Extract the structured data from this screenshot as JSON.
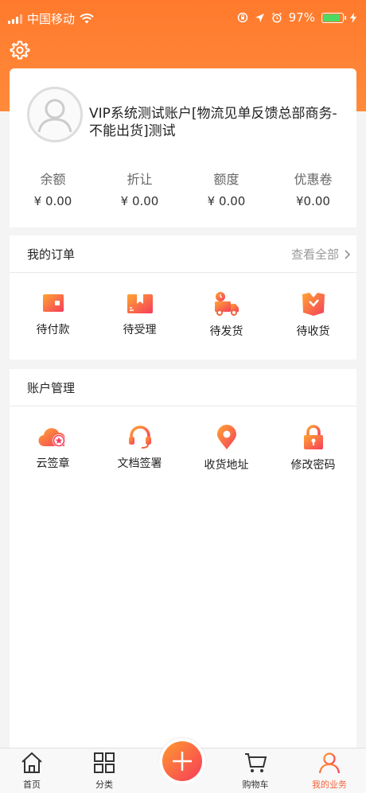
{
  "status_bar": {
    "carrier": "中国移动",
    "battery_percent": "97%",
    "battery_level": 0.97
  },
  "profile": {
    "account_name": "VIP系统测试账户[物流见单反馈总部商务-不能出货]测试",
    "stats": [
      {
        "label": "余额",
        "value": "¥ 0.00"
      },
      {
        "label": "折让",
        "value": "¥ 0.00"
      },
      {
        "label": "额度",
        "value": "¥ 0.00"
      },
      {
        "label": "优惠卷",
        "value": "¥0.00"
      }
    ]
  },
  "orders": {
    "title": "我的订单",
    "view_all": "查看全部",
    "items": [
      {
        "label": "待付款",
        "icon": "wallet-icon"
      },
      {
        "label": "待受理",
        "icon": "package-icon"
      },
      {
        "label": "待发货",
        "icon": "truck-icon"
      },
      {
        "label": "待收货",
        "icon": "receive-box-icon"
      }
    ]
  },
  "account": {
    "title": "账户管理",
    "items": [
      {
        "label": "云签章",
        "icon": "cloud-seal-icon"
      },
      {
        "label": "文档签署",
        "icon": "headset-icon"
      },
      {
        "label": "收货地址",
        "icon": "location-pin-icon"
      },
      {
        "label": "修改密码",
        "icon": "lock-icon"
      }
    ]
  },
  "bottom_nav": {
    "items": [
      {
        "label": "首页",
        "icon": "home-icon"
      },
      {
        "label": "分类",
        "icon": "grid-icon"
      },
      {
        "label": "购物车",
        "icon": "cart-icon"
      },
      {
        "label": "我的业务",
        "icon": "user-icon"
      }
    ],
    "active": "我的业务"
  },
  "colors": {
    "brand_orange": "#ff7a2d",
    "gradient_start": "#ff9a2e",
    "gradient_end": "#f63b5a",
    "active_nav": "#f5623d"
  }
}
